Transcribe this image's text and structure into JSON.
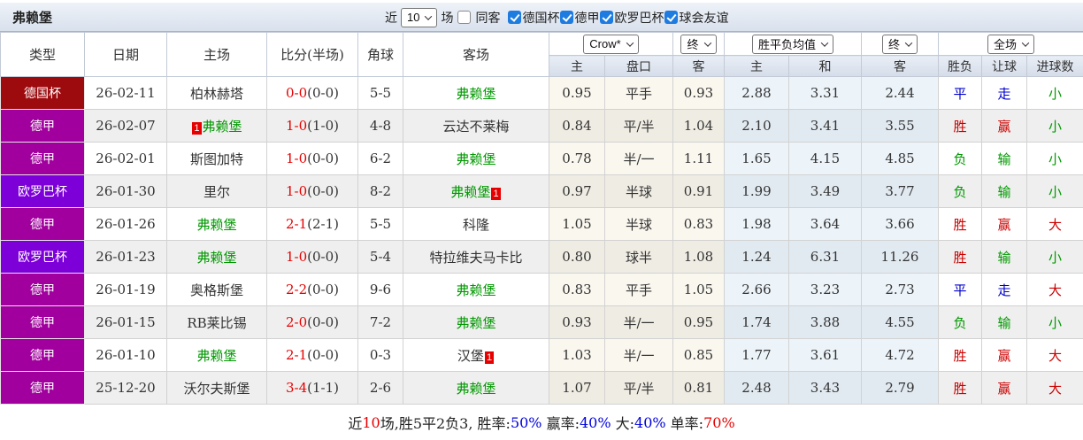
{
  "header_bar": {
    "title": "弗赖堡",
    "near_label": "近",
    "matches_count": "10",
    "matches_label": "场",
    "same_away_label": "同客",
    "same_away_checked": false,
    "filters": [
      {
        "label": "德国杯",
        "checked": true
      },
      {
        "label": "德甲",
        "checked": true
      },
      {
        "label": "欧罗巴杯",
        "checked": true
      },
      {
        "label": "球会友谊",
        "checked": true
      }
    ]
  },
  "table": {
    "left_headers": [
      "类型",
      "日期",
      "主场",
      "比分(半场)",
      "角球",
      "客场"
    ],
    "selects": {
      "bookmaker": "Crow*",
      "handicap_time": "终",
      "mean_label": "胜平负均值",
      "mean_time": "终",
      "scope": "全场"
    },
    "sub_headers": [
      "主",
      "盘口",
      "客",
      "主",
      "和",
      "客",
      "胜负",
      "让球",
      "进球数"
    ],
    "rows": [
      {
        "type": "德国杯",
        "date": "26-02-11",
        "home": {
          "name": "柏林赫塔",
          "green": false,
          "badge": null
        },
        "ft": "0-0",
        "ht": "(0-0)",
        "corners": "5-5",
        "away": {
          "name": "弗赖堡",
          "green": true,
          "badge": null
        },
        "odds": [
          "0.95",
          "平手",
          "0.93"
        ],
        "mean": [
          "2.88",
          "3.31",
          "2.44"
        ],
        "res": [
          {
            "t": "平",
            "c": "blue"
          },
          {
            "t": "走",
            "c": "blue"
          },
          {
            "t": "小",
            "c": "green"
          }
        ]
      },
      {
        "type": "德甲",
        "date": "26-02-07",
        "home": {
          "name": "弗赖堡",
          "green": true,
          "badge": "pre"
        },
        "ft": "1-0",
        "ht": "(1-0)",
        "corners": "4-8",
        "away": {
          "name": "云达不莱梅",
          "green": false,
          "badge": null
        },
        "odds": [
          "0.84",
          "平/半",
          "1.04"
        ],
        "mean": [
          "2.10",
          "3.41",
          "3.55"
        ],
        "res": [
          {
            "t": "胜",
            "c": "red"
          },
          {
            "t": "赢",
            "c": "red"
          },
          {
            "t": "小",
            "c": "green"
          }
        ]
      },
      {
        "type": "德甲",
        "date": "26-02-01",
        "home": {
          "name": "斯图加特",
          "green": false,
          "badge": null
        },
        "ft": "1-0",
        "ht": "(0-0)",
        "corners": "6-2",
        "away": {
          "name": "弗赖堡",
          "green": true,
          "badge": null
        },
        "odds": [
          "0.78",
          "半/一",
          "1.11"
        ],
        "mean": [
          "1.65",
          "4.15",
          "4.85"
        ],
        "res": [
          {
            "t": "负",
            "c": "green"
          },
          {
            "t": "输",
            "c": "green"
          },
          {
            "t": "小",
            "c": "green"
          }
        ]
      },
      {
        "type": "欧罗巴杯",
        "date": "26-01-30",
        "home": {
          "name": "里尔",
          "green": false,
          "badge": null
        },
        "ft": "1-0",
        "ht": "(0-0)",
        "corners": "8-2",
        "away": {
          "name": "弗赖堡",
          "green": true,
          "badge": "post"
        },
        "odds": [
          "0.97",
          "半球",
          "0.91"
        ],
        "mean": [
          "1.99",
          "3.49",
          "3.77"
        ],
        "res": [
          {
            "t": "负",
            "c": "green"
          },
          {
            "t": "输",
            "c": "green"
          },
          {
            "t": "小",
            "c": "green"
          }
        ]
      },
      {
        "type": "德甲",
        "date": "26-01-26",
        "home": {
          "name": "弗赖堡",
          "green": true,
          "badge": null
        },
        "ft": "2-1",
        "ht": "(2-1)",
        "corners": "5-5",
        "away": {
          "name": "科隆",
          "green": false,
          "badge": null
        },
        "odds": [
          "1.05",
          "半球",
          "0.83"
        ],
        "mean": [
          "1.98",
          "3.64",
          "3.66"
        ],
        "res": [
          {
            "t": "胜",
            "c": "red"
          },
          {
            "t": "赢",
            "c": "red"
          },
          {
            "t": "大",
            "c": "red"
          }
        ]
      },
      {
        "type": "欧罗巴杯",
        "date": "26-01-23",
        "home": {
          "name": "弗赖堡",
          "green": true,
          "badge": null
        },
        "ft": "1-0",
        "ht": "(0-0)",
        "corners": "5-4",
        "away": {
          "name": "特拉维夫马卡比",
          "green": false,
          "badge": null
        },
        "odds": [
          "0.80",
          "球半",
          "1.08"
        ],
        "mean": [
          "1.24",
          "6.31",
          "11.26"
        ],
        "res": [
          {
            "t": "胜",
            "c": "red"
          },
          {
            "t": "输",
            "c": "green"
          },
          {
            "t": "小",
            "c": "green"
          }
        ]
      },
      {
        "type": "德甲",
        "date": "26-01-19",
        "home": {
          "name": "奥格斯堡",
          "green": false,
          "badge": null
        },
        "ft": "2-2",
        "ht": "(0-0)",
        "corners": "9-6",
        "away": {
          "name": "弗赖堡",
          "green": true,
          "badge": null
        },
        "odds": [
          "0.83",
          "平手",
          "1.05"
        ],
        "mean": [
          "2.66",
          "3.23",
          "2.73"
        ],
        "res": [
          {
            "t": "平",
            "c": "blue"
          },
          {
            "t": "走",
            "c": "blue"
          },
          {
            "t": "大",
            "c": "red"
          }
        ]
      },
      {
        "type": "德甲",
        "date": "26-01-15",
        "home": {
          "name": "RB莱比锡",
          "green": false,
          "badge": null
        },
        "ft": "2-0",
        "ht": "(0-0)",
        "corners": "7-2",
        "away": {
          "name": "弗赖堡",
          "green": true,
          "badge": null
        },
        "odds": [
          "0.93",
          "半/一",
          "0.95"
        ],
        "mean": [
          "1.74",
          "3.88",
          "4.55"
        ],
        "res": [
          {
            "t": "负",
            "c": "green"
          },
          {
            "t": "输",
            "c": "green"
          },
          {
            "t": "小",
            "c": "green"
          }
        ]
      },
      {
        "type": "德甲",
        "date": "26-01-10",
        "home": {
          "name": "弗赖堡",
          "green": true,
          "badge": null
        },
        "ft": "2-1",
        "ht": "(0-0)",
        "corners": "0-3",
        "away": {
          "name": "汉堡",
          "green": false,
          "badge": "post"
        },
        "odds": [
          "1.03",
          "半/一",
          "0.85"
        ],
        "mean": [
          "1.77",
          "3.61",
          "4.72"
        ],
        "res": [
          {
            "t": "胜",
            "c": "red"
          },
          {
            "t": "赢",
            "c": "red"
          },
          {
            "t": "大",
            "c": "red"
          }
        ]
      },
      {
        "type": "德甲",
        "date": "25-12-20",
        "home": {
          "name": "沃尔夫斯堡",
          "green": false,
          "badge": null
        },
        "ft": "3-4",
        "ht": "(1-1)",
        "corners": "2-6",
        "away": {
          "name": "弗赖堡",
          "green": true,
          "badge": null
        },
        "odds": [
          "1.07",
          "平/半",
          "0.81"
        ],
        "mean": [
          "2.48",
          "3.43",
          "2.79"
        ],
        "res": [
          {
            "t": "胜",
            "c": "red"
          },
          {
            "t": "赢",
            "c": "red"
          },
          {
            "t": "大",
            "c": "red"
          }
        ]
      }
    ]
  },
  "footer": {
    "segments": [
      {
        "text": "近",
        "color": "black"
      },
      {
        "text": "10",
        "color": "red"
      },
      {
        "text": "场,胜5平2负3, 胜率:",
        "color": "black"
      },
      {
        "text": "50%",
        "color": "blue"
      },
      {
        "text": " 赢率:",
        "color": "black"
      },
      {
        "text": "40%",
        "color": "blue"
      },
      {
        "text": " 大:",
        "color": "black"
      },
      {
        "text": "40%",
        "color": "blue"
      },
      {
        "text": " 单率:",
        "color": "black"
      },
      {
        "text": "70%",
        "color": "red"
      }
    ]
  },
  "colors": {
    "type_badge": {
      "德国杯": "#9e0b0f",
      "德甲": "#a1009e",
      "欧罗巴杯": "#7d00d8"
    },
    "score_red": "#e60000",
    "team_green": "#009900",
    "result_red": "#cc0000",
    "result_green": "#009900",
    "result_blue": "#0000cc"
  },
  "badge_rank_label": "1"
}
